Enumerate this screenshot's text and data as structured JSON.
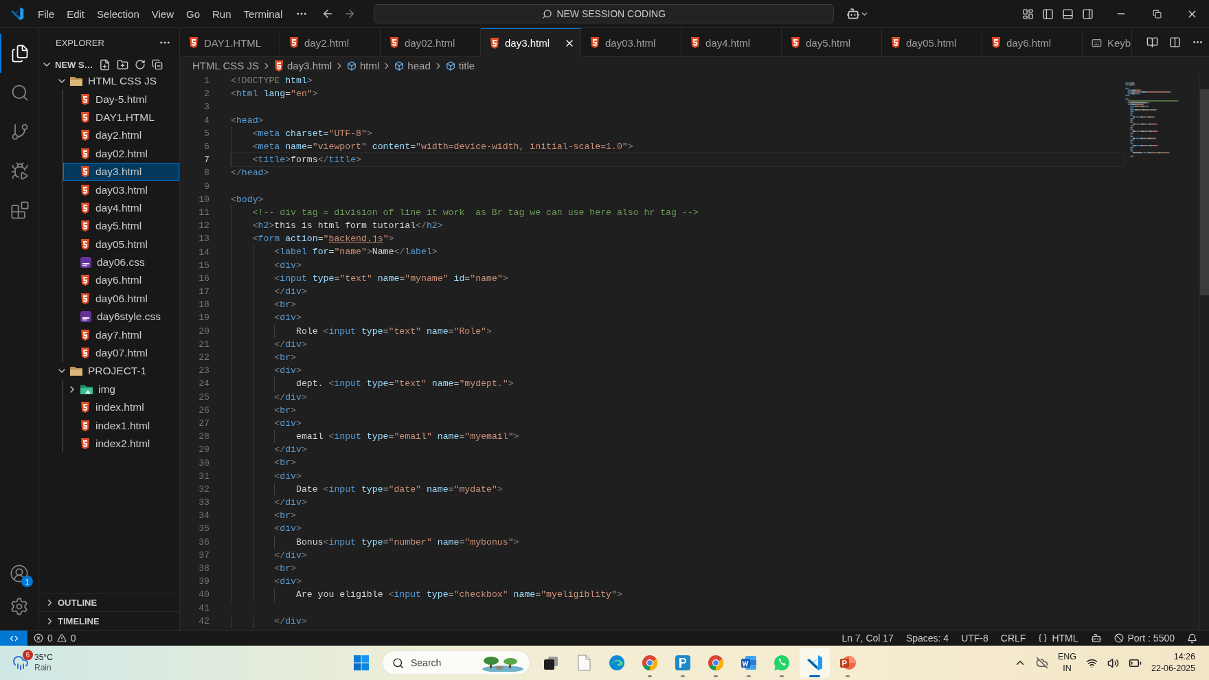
{
  "title_bar": {
    "menu": [
      "File",
      "Edit",
      "Selection",
      "View",
      "Go",
      "Run",
      "Terminal"
    ],
    "command_center": "NEW SESSION CODING"
  },
  "activity_bar": {
    "items": [
      {
        "kind": "explorer",
        "selected": true
      },
      {
        "kind": "search",
        "selected": false
      },
      {
        "kind": "source-control",
        "selected": false
      },
      {
        "kind": "run-debug",
        "selected": false
      },
      {
        "kind": "extensions",
        "selected": false
      }
    ],
    "account_badge": "1"
  },
  "sidebar": {
    "title": "EXPLORER",
    "root": {
      "label": "NEW S…",
      "expanded": true
    },
    "tree": [
      {
        "label": "HTML CSS JS",
        "kind": "folder",
        "expanded": true,
        "selected": false,
        "children": [
          {
            "label": "Day-5.html",
            "kind": "html",
            "selected": false
          },
          {
            "label": "DAY1.HTML",
            "kind": "html",
            "selected": false
          },
          {
            "label": "day2.html",
            "kind": "html",
            "selected": false
          },
          {
            "label": "day02.html",
            "kind": "html",
            "selected": false
          },
          {
            "label": "day3.html",
            "kind": "html",
            "selected": true
          },
          {
            "label": "day03.html",
            "kind": "html",
            "selected": false
          },
          {
            "label": "day4.html",
            "kind": "html",
            "selected": false
          },
          {
            "label": "day5.html",
            "kind": "html",
            "selected": false
          },
          {
            "label": "day05.html",
            "kind": "html",
            "selected": false
          },
          {
            "label": "day06.css",
            "kind": "css",
            "selected": false
          },
          {
            "label": "day6.html",
            "kind": "html",
            "selected": false
          },
          {
            "label": "day06.html",
            "kind": "html",
            "selected": false
          },
          {
            "label": "day6style.css",
            "kind": "css",
            "selected": false
          },
          {
            "label": "day7.html",
            "kind": "html",
            "selected": false
          },
          {
            "label": "day07.html",
            "kind": "html",
            "selected": false
          }
        ]
      },
      {
        "label": "PROJECT-1",
        "kind": "folder",
        "expanded": true,
        "selected": false,
        "children": [
          {
            "label": "img",
            "kind": "image-folder",
            "expanded": false,
            "selected": false
          },
          {
            "label": "index.html",
            "kind": "html",
            "selected": false
          },
          {
            "label": "index1.html",
            "kind": "html",
            "selected": false
          },
          {
            "label": "index2.html",
            "kind": "html",
            "selected": false
          }
        ]
      }
    ],
    "panels": [
      {
        "label": "OUTLINE",
        "expanded": false
      },
      {
        "label": "TIMELINE",
        "expanded": false
      }
    ]
  },
  "tabs": [
    {
      "label": "DAY1.HTML",
      "kind": "html",
      "selected": false
    },
    {
      "label": "day2.html",
      "kind": "html",
      "selected": false
    },
    {
      "label": "day02.html",
      "kind": "html",
      "selected": false
    },
    {
      "label": "day3.html",
      "kind": "html",
      "selected": true
    },
    {
      "label": "day03.html",
      "kind": "html",
      "selected": false
    },
    {
      "label": "day4.html",
      "kind": "html",
      "selected": false
    },
    {
      "label": "day5.html",
      "kind": "html",
      "selected": false
    },
    {
      "label": "day05.html",
      "kind": "html",
      "selected": false
    },
    {
      "label": "day6.html",
      "kind": "html",
      "selected": false
    },
    {
      "label": "Keyb",
      "kind": "keyboard",
      "selected": false
    }
  ],
  "breadcrumb": [
    {
      "label": "HTML CSS JS",
      "kind": "folder"
    },
    {
      "label": "day3.html",
      "kind": "html"
    },
    {
      "label": "html",
      "kind": "element"
    },
    {
      "label": "head",
      "kind": "element"
    },
    {
      "label": "title",
      "kind": "element"
    }
  ],
  "editor": {
    "lines": [
      {
        "n": "1",
        "current": false,
        "tokens": [
          {
            "kind": "punct",
            "text": "<!DOCTYPE"
          },
          {
            "kind": "attr",
            "text": " html"
          },
          {
            "kind": "punct",
            "text": ">"
          }
        ]
      },
      {
        "n": "2",
        "current": false,
        "tokens": [
          {
            "kind": "punct",
            "text": "<"
          },
          {
            "kind": "tag",
            "text": "html"
          },
          {
            "kind": "attr",
            "text": " lang"
          },
          {
            "kind": "text",
            "text": "="
          },
          {
            "kind": "string",
            "text": "\"en\""
          },
          {
            "kind": "punct",
            "text": ">"
          }
        ]
      },
      {
        "n": "3",
        "current": false
      },
      {
        "n": "4",
        "current": false,
        "tokens": [
          {
            "kind": "punct",
            "text": "<"
          },
          {
            "kind": "tag",
            "text": "head"
          },
          {
            "kind": "punct",
            "text": ">"
          }
        ]
      },
      {
        "n": "5",
        "current": false,
        "tokens": [
          {
            "kind": "punct",
            "text": "    <"
          },
          {
            "kind": "tag",
            "text": "meta"
          },
          {
            "kind": "attr",
            "text": " charset"
          },
          {
            "kind": "text",
            "text": "="
          },
          {
            "kind": "string",
            "text": "\"UTF-8\""
          },
          {
            "kind": "punct",
            "text": ">"
          }
        ]
      },
      {
        "n": "6",
        "current": false,
        "tokens": [
          {
            "kind": "punct",
            "text": "    <"
          },
          {
            "kind": "tag",
            "text": "meta"
          },
          {
            "kind": "attr",
            "text": " name"
          },
          {
            "kind": "text",
            "text": "="
          },
          {
            "kind": "string",
            "text": "\"viewport\""
          },
          {
            "kind": "attr",
            "text": " content"
          },
          {
            "kind": "text",
            "text": "="
          },
          {
            "kind": "string",
            "text": "\"width=device-width, initial-scale=1.0\""
          },
          {
            "kind": "punct",
            "text": ">"
          }
        ]
      },
      {
        "n": "7",
        "current": true,
        "tokens": [
          {
            "kind": "punct",
            "text": "    <"
          },
          {
            "kind": "tag",
            "text": "title"
          },
          {
            "kind": "punct",
            "text": ">"
          },
          {
            "kind": "text",
            "text": "forms"
          },
          {
            "kind": "punct",
            "text": "</"
          },
          {
            "kind": "tag",
            "text": "title"
          },
          {
            "kind": "punct",
            "text": ">"
          }
        ]
      },
      {
        "n": "8",
        "current": false,
        "tokens": [
          {
            "kind": "punct",
            "text": "</"
          },
          {
            "kind": "tag",
            "text": "head"
          },
          {
            "kind": "punct",
            "text": ">"
          }
        ]
      },
      {
        "n": "9",
        "current": false
      },
      {
        "n": "10",
        "current": false,
        "tokens": [
          {
            "kind": "punct",
            "text": "<"
          },
          {
            "kind": "tag",
            "text": "body"
          },
          {
            "kind": "punct",
            "text": ">"
          }
        ]
      },
      {
        "n": "11",
        "current": false,
        "tokens": [
          {
            "kind": "comment",
            "text": "    <!-- div tag = division of line it work  as Br tag we can use here also hr tag -->"
          }
        ]
      },
      {
        "n": "12",
        "current": false,
        "tokens": [
          {
            "kind": "punct",
            "text": "    <"
          },
          {
            "kind": "tag",
            "text": "h2"
          },
          {
            "kind": "punct",
            "text": ">"
          },
          {
            "kind": "text",
            "text": "this is html form tutorial"
          },
          {
            "kind": "punct",
            "text": "</"
          },
          {
            "kind": "tag",
            "text": "h2"
          },
          {
            "kind": "punct",
            "text": ">"
          }
        ]
      },
      {
        "n": "13",
        "current": false,
        "tokens": [
          {
            "kind": "punct",
            "text": "    <"
          },
          {
            "kind": "tag",
            "text": "form"
          },
          {
            "kind": "attr",
            "text": " action"
          },
          {
            "kind": "text",
            "text": "="
          },
          {
            "kind": "string",
            "text": "\""
          },
          {
            "kind": "link",
            "text": "backend.js"
          },
          {
            "kind": "string",
            "text": "\""
          },
          {
            "kind": "punct",
            "text": ">"
          }
        ]
      },
      {
        "n": "14",
        "current": false,
        "tokens": [
          {
            "kind": "punct",
            "text": "        <"
          },
          {
            "kind": "tag",
            "text": "label"
          },
          {
            "kind": "attr",
            "text": " for"
          },
          {
            "kind": "text",
            "text": "="
          },
          {
            "kind": "string",
            "text": "\"name\""
          },
          {
            "kind": "punct",
            "text": ">"
          },
          {
            "kind": "text",
            "text": "Name"
          },
          {
            "kind": "punct",
            "text": "</"
          },
          {
            "kind": "tag",
            "text": "label"
          },
          {
            "kind": "punct",
            "text": ">"
          }
        ]
      },
      {
        "n": "15",
        "current": false,
        "tokens": [
          {
            "kind": "punct",
            "text": "        <"
          },
          {
            "kind": "tag",
            "text": "div"
          },
          {
            "kind": "punct",
            "text": ">"
          }
        ]
      },
      {
        "n": "16",
        "current": false,
        "tokens": [
          {
            "kind": "punct",
            "text": "        <"
          },
          {
            "kind": "tag",
            "text": "input"
          },
          {
            "kind": "attr",
            "text": " type"
          },
          {
            "kind": "text",
            "text": "="
          },
          {
            "kind": "string",
            "text": "\"text\""
          },
          {
            "kind": "attr",
            "text": " name"
          },
          {
            "kind": "text",
            "text": "="
          },
          {
            "kind": "string",
            "text": "\"myname\""
          },
          {
            "kind": "attr",
            "text": " id"
          },
          {
            "kind": "text",
            "text": "="
          },
          {
            "kind": "string",
            "text": "\"name\""
          },
          {
            "kind": "punct",
            "text": ">"
          }
        ]
      },
      {
        "n": "17",
        "current": false,
        "tokens": [
          {
            "kind": "punct",
            "text": "        </"
          },
          {
            "kind": "tag",
            "text": "div"
          },
          {
            "kind": "punct",
            "text": ">"
          }
        ]
      },
      {
        "n": "18",
        "current": false,
        "tokens": [
          {
            "kind": "punct",
            "text": "        <"
          },
          {
            "kind": "tag",
            "text": "br"
          },
          {
            "kind": "punct",
            "text": ">"
          }
        ]
      },
      {
        "n": "19",
        "current": false,
        "tokens": [
          {
            "kind": "punct",
            "text": "        <"
          },
          {
            "kind": "tag",
            "text": "div"
          },
          {
            "kind": "punct",
            "text": ">"
          }
        ]
      },
      {
        "n": "20",
        "current": false,
        "tokens": [
          {
            "kind": "text",
            "text": "            Role "
          },
          {
            "kind": "punct",
            "text": "<"
          },
          {
            "kind": "tag",
            "text": "input"
          },
          {
            "kind": "attr",
            "text": " type"
          },
          {
            "kind": "text",
            "text": "="
          },
          {
            "kind": "string",
            "text": "\"text\""
          },
          {
            "kind": "attr",
            "text": " name"
          },
          {
            "kind": "text",
            "text": "="
          },
          {
            "kind": "string",
            "text": "\"Role\""
          },
          {
            "kind": "punct",
            "text": ">"
          }
        ]
      },
      {
        "n": "21",
        "current": false,
        "tokens": [
          {
            "kind": "punct",
            "text": "        </"
          },
          {
            "kind": "tag",
            "text": "div"
          },
          {
            "kind": "punct",
            "text": ">"
          }
        ]
      },
      {
        "n": "22",
        "current": false,
        "tokens": [
          {
            "kind": "punct",
            "text": "        <"
          },
          {
            "kind": "tag",
            "text": "br"
          },
          {
            "kind": "punct",
            "text": ">"
          }
        ]
      },
      {
        "n": "23",
        "current": false,
        "tokens": [
          {
            "kind": "punct",
            "text": "        <"
          },
          {
            "kind": "tag",
            "text": "div"
          },
          {
            "kind": "punct",
            "text": ">"
          }
        ]
      },
      {
        "n": "24",
        "current": false,
        "tokens": [
          {
            "kind": "text",
            "text": "            dept. "
          },
          {
            "kind": "punct",
            "text": "<"
          },
          {
            "kind": "tag",
            "text": "input"
          },
          {
            "kind": "attr",
            "text": " type"
          },
          {
            "kind": "text",
            "text": "="
          },
          {
            "kind": "string",
            "text": "\"text\""
          },
          {
            "kind": "attr",
            "text": " name"
          },
          {
            "kind": "text",
            "text": "="
          },
          {
            "kind": "string",
            "text": "\"mydept.\""
          },
          {
            "kind": "punct",
            "text": ">"
          }
        ]
      },
      {
        "n": "25",
        "current": false,
        "tokens": [
          {
            "kind": "punct",
            "text": "        </"
          },
          {
            "kind": "tag",
            "text": "div"
          },
          {
            "kind": "punct",
            "text": ">"
          }
        ]
      },
      {
        "n": "26",
        "current": false,
        "tokens": [
          {
            "kind": "punct",
            "text": "        <"
          },
          {
            "kind": "tag",
            "text": "br"
          },
          {
            "kind": "punct",
            "text": ">"
          }
        ]
      },
      {
        "n": "27",
        "current": false,
        "tokens": [
          {
            "kind": "punct",
            "text": "        <"
          },
          {
            "kind": "tag",
            "text": "div"
          },
          {
            "kind": "punct",
            "text": ">"
          }
        ]
      },
      {
        "n": "28",
        "current": false,
        "tokens": [
          {
            "kind": "text",
            "text": "            email "
          },
          {
            "kind": "punct",
            "text": "<"
          },
          {
            "kind": "tag",
            "text": "input"
          },
          {
            "kind": "attr",
            "text": " type"
          },
          {
            "kind": "text",
            "text": "="
          },
          {
            "kind": "string",
            "text": "\"email\""
          },
          {
            "kind": "attr",
            "text": " name"
          },
          {
            "kind": "text",
            "text": "="
          },
          {
            "kind": "string",
            "text": "\"myemail\""
          },
          {
            "kind": "punct",
            "text": ">"
          }
        ]
      },
      {
        "n": "29",
        "current": false,
        "tokens": [
          {
            "kind": "punct",
            "text": "        </"
          },
          {
            "kind": "tag",
            "text": "div"
          },
          {
            "kind": "punct",
            "text": ">"
          }
        ]
      },
      {
        "n": "30",
        "current": false,
        "tokens": [
          {
            "kind": "punct",
            "text": "        <"
          },
          {
            "kind": "tag",
            "text": "br"
          },
          {
            "kind": "punct",
            "text": ">"
          }
        ]
      },
      {
        "n": "31",
        "current": false,
        "tokens": [
          {
            "kind": "punct",
            "text": "        <"
          },
          {
            "kind": "tag",
            "text": "div"
          },
          {
            "kind": "punct",
            "text": ">"
          }
        ]
      },
      {
        "n": "32",
        "current": false,
        "tokens": [
          {
            "kind": "text",
            "text": "            Date "
          },
          {
            "kind": "punct",
            "text": "<"
          },
          {
            "kind": "tag",
            "text": "input"
          },
          {
            "kind": "attr",
            "text": " type"
          },
          {
            "kind": "text",
            "text": "="
          },
          {
            "kind": "string",
            "text": "\"date\""
          },
          {
            "kind": "attr",
            "text": " name"
          },
          {
            "kind": "text",
            "text": "="
          },
          {
            "kind": "string",
            "text": "\"mydate\""
          },
          {
            "kind": "punct",
            "text": ">"
          }
        ]
      },
      {
        "n": "33",
        "current": false,
        "tokens": [
          {
            "kind": "punct",
            "text": "        </"
          },
          {
            "kind": "tag",
            "text": "div"
          },
          {
            "kind": "punct",
            "text": ">"
          }
        ]
      },
      {
        "n": "34",
        "current": false,
        "tokens": [
          {
            "kind": "punct",
            "text": "        <"
          },
          {
            "kind": "tag",
            "text": "br"
          },
          {
            "kind": "punct",
            "text": ">"
          }
        ]
      },
      {
        "n": "35",
        "current": false,
        "tokens": [
          {
            "kind": "punct",
            "text": "        <"
          },
          {
            "kind": "tag",
            "text": "div"
          },
          {
            "kind": "punct",
            "text": ">"
          }
        ]
      },
      {
        "n": "36",
        "current": false,
        "tokens": [
          {
            "kind": "text",
            "text": "            Bonus"
          },
          {
            "kind": "punct",
            "text": "<"
          },
          {
            "kind": "tag",
            "text": "input"
          },
          {
            "kind": "attr",
            "text": " type"
          },
          {
            "kind": "text",
            "text": "="
          },
          {
            "kind": "string",
            "text": "\"number\""
          },
          {
            "kind": "attr",
            "text": " name"
          },
          {
            "kind": "text",
            "text": "="
          },
          {
            "kind": "string",
            "text": "\"mybonus\""
          },
          {
            "kind": "punct",
            "text": ">"
          }
        ]
      },
      {
        "n": "37",
        "current": false,
        "tokens": [
          {
            "kind": "punct",
            "text": "        </"
          },
          {
            "kind": "tag",
            "text": "div"
          },
          {
            "kind": "punct",
            "text": ">"
          }
        ]
      },
      {
        "n": "38",
        "current": false,
        "tokens": [
          {
            "kind": "punct",
            "text": "        <"
          },
          {
            "kind": "tag",
            "text": "br"
          },
          {
            "kind": "punct",
            "text": ">"
          }
        ]
      },
      {
        "n": "39",
        "current": false,
        "tokens": [
          {
            "kind": "punct",
            "text": "        <"
          },
          {
            "kind": "tag",
            "text": "div"
          },
          {
            "kind": "punct",
            "text": ">"
          }
        ]
      },
      {
        "n": "40",
        "current": false,
        "tokens": [
          {
            "kind": "text",
            "text": "            Are you eligible "
          },
          {
            "kind": "punct",
            "text": "<"
          },
          {
            "kind": "tag",
            "text": "input"
          },
          {
            "kind": "attr",
            "text": " type"
          },
          {
            "kind": "text",
            "text": "="
          },
          {
            "kind": "string",
            "text": "\"checkbox\""
          },
          {
            "kind": "attr",
            "text": " name"
          },
          {
            "kind": "text",
            "text": "="
          },
          {
            "kind": "string",
            "text": "\"myeligiblity\""
          },
          {
            "kind": "punct",
            "text": ">"
          }
        ]
      },
      {
        "n": "41",
        "current": false
      },
      {
        "n": "42",
        "current": false,
        "tokens": [
          {
            "kind": "punct",
            "text": "        </"
          },
          {
            "kind": "tag",
            "text": "div"
          },
          {
            "kind": "punct",
            "text": ">"
          }
        ]
      }
    ]
  },
  "status_bar": {
    "errors": "0",
    "warnings": "0",
    "items": [
      {
        "kind": "text",
        "text": "Ln 7, Col 17"
      },
      {
        "kind": "text",
        "text": "Spaces: 4"
      },
      {
        "kind": "text",
        "text": "UTF-8"
      },
      {
        "kind": "text",
        "text": "CRLF"
      },
      {
        "kind": "language",
        "text": "HTML"
      },
      {
        "kind": "copilot"
      },
      {
        "kind": "port",
        "text": "Port : 5500"
      },
      {
        "kind": "bell"
      }
    ]
  },
  "taskbar": {
    "weather": {
      "badge": "6",
      "temperature": "35°C",
      "condition": "Rain"
    },
    "search_placeholder": "Search",
    "apps": [
      {
        "kind": "task-view",
        "running": false,
        "selected": false
      },
      {
        "kind": "notepad",
        "running": false,
        "selected": false
      },
      {
        "kind": "edge",
        "running": false,
        "selected": false
      },
      {
        "kind": "chrome",
        "running": true,
        "selected": false
      },
      {
        "kind": "pay",
        "running": true,
        "selected": false
      },
      {
        "kind": "chrome",
        "running": true,
        "selected": false
      },
      {
        "kind": "word",
        "running": true,
        "selected": false
      },
      {
        "kind": "whatsapp",
        "running": true,
        "selected": false
      },
      {
        "kind": "vscode",
        "running": true,
        "selected": true
      },
      {
        "kind": "powerpoint",
        "running": true,
        "selected": false
      }
    ],
    "language": "ENG",
    "region": "IN",
    "time": "14:26",
    "date": "22-06-2025"
  }
}
